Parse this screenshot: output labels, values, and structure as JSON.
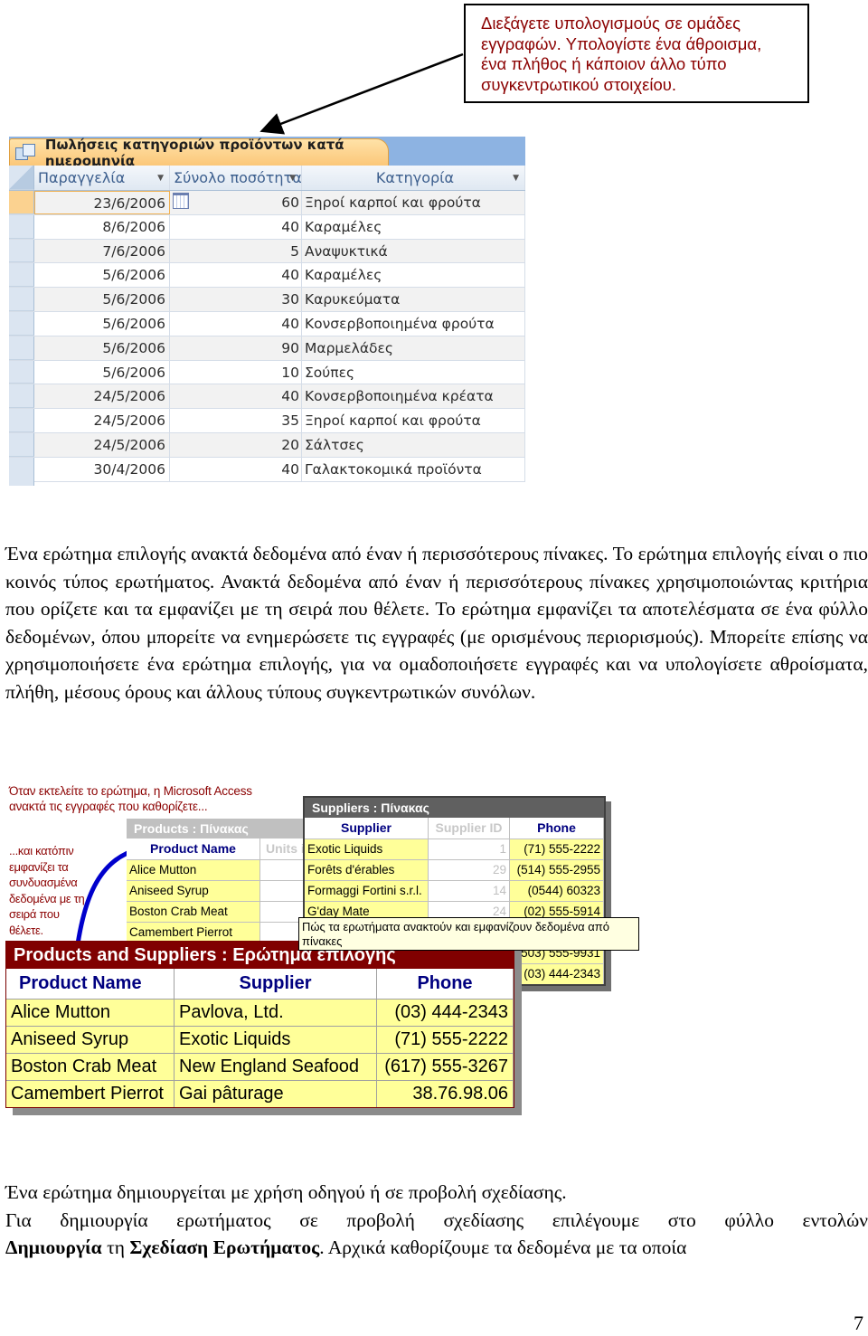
{
  "callout": {
    "lines": [
      "Διεξάγετε υπολογισμούς σε ομάδες",
      "εγγραφών. Υπολογίστε ένα άθροισμα,",
      "ένα πλήθος ή κάποιον άλλο τύπο",
      "συγκεντρωτικού στοιχείου."
    ]
  },
  "datasheet": {
    "tab_title": "Πωλήσεις κατηγοριών προϊόντων κατά ημερομηνία",
    "tab_icon": "query-datasheet-icon",
    "columns": [
      "Παραγγελία",
      "Σύνολο ποσότητα",
      "Κατηγορία"
    ],
    "rows": [
      {
        "date": "23/6/2006",
        "qty": "60",
        "category": "Ξηροί καρποί και φρούτα"
      },
      {
        "date": "8/6/2006",
        "qty": "40",
        "category": "Καραμέλες"
      },
      {
        "date": "7/6/2006",
        "qty": "5",
        "category": "Αναψυκτικά"
      },
      {
        "date": "5/6/2006",
        "qty": "40",
        "category": "Καραμέλες"
      },
      {
        "date": "5/6/2006",
        "qty": "30",
        "category": "Καρυκεύματα"
      },
      {
        "date": "5/6/2006",
        "qty": "40",
        "category": "Κονσερβοποιημένα φρούτα"
      },
      {
        "date": "5/6/2006",
        "qty": "90",
        "category": "Μαρμελάδες"
      },
      {
        "date": "5/6/2006",
        "qty": "10",
        "category": "Σούπες"
      },
      {
        "date": "24/5/2006",
        "qty": "40",
        "category": "Κονσερβοποιημένα κρέατα"
      },
      {
        "date": "24/5/2006",
        "qty": "35",
        "category": "Ξηροί καρποί και φρούτα"
      },
      {
        "date": "24/5/2006",
        "qty": "20",
        "category": "Σάλτσες"
      },
      {
        "date": "30/4/2006",
        "qty": "40",
        "category": "Γαλακτοκομικά προϊόντα"
      }
    ]
  },
  "paragraph1": "Ένα ερώτημα επιλογής ανακτά δεδομένα από έναν ή περισσότερους πίνακες. Το ερώτημα επιλογής είναι ο πιο κοινός τύπος ερωτήματος. Ανακτά δεδομένα από έναν ή περισσότερους πίνακες χρησιμοποιώντας κριτήρια που ορίζετε και τα εμφανίζει με τη σειρά που θέλετε. Το ερώτημα εμφανίζει τα αποτελέσματα σε ένα φύλλο δεδομένων, όπου μπορείτε να ενημερώσετε τις εγγραφές (με ορισμένους περιορισμούς). Μπορείτε επίσης να χρησιμοποιήσετε ένα ερώτημα επιλογής, για να ομαδοποιήσετε εγγραφές και να υπολογίσετε αθροίσματα, πλήθη, μέσους όρους και άλλους τύπους συγκεντρωτικών συνόλων.",
  "figure": {
    "intro_line1": "Όταν εκτελείτε το ερώτημα, η Microsoft Access",
    "intro_line2": "ανακτά τις εγγραφές που καθορίζετε...",
    "side_text": "...και κατόπιν εμφανίζει τα συνδυασμένα δεδομένα με τη σειρά που θέλετε.",
    "products_table": {
      "title": "Products : Πίνακας",
      "columns": [
        "Product Name",
        "Units i"
      ],
      "rows": [
        "Alice Mutton",
        "Aniseed Syrup",
        "Boston Crab Meat",
        "Camembert Pierrot"
      ]
    },
    "suppliers_table": {
      "title": "Suppliers : Πίνακας",
      "columns": [
        "Supplier",
        "Supplier ID",
        "Phone"
      ],
      "rows": [
        {
          "supplier": "Exotic Liquids",
          "id": "1",
          "phone": "(71) 555-2222"
        },
        {
          "supplier": "Forêts d'érables",
          "id": "29",
          "phone": "(514) 555-2955"
        },
        {
          "supplier": "Formaggi Fortini s.r.l.",
          "id": "14",
          "phone": "(0544) 60323"
        },
        {
          "supplier": "G'day Mate",
          "id": "24",
          "phone": "(02) 555-5914"
        },
        {
          "supplier": "",
          "id": "",
          "phone": ""
        },
        {
          "supplier": "",
          "id": "",
          "phone": "(503) 555-9931"
        },
        {
          "supplier": "",
          "id": "",
          "phone": "(03) 444-2343"
        }
      ]
    },
    "tooltip": "Πώς τα ερωτήματα ανακτούν και εμφανίζουν δεδομένα από πίνακες",
    "query_table": {
      "title": "Products and Suppliers : Ερώτημα επιλογής",
      "columns": [
        "Product Name",
        "Supplier",
        "Phone"
      ],
      "rows": [
        {
          "product": "Alice Mutton",
          "supplier": "Pavlova, Ltd.",
          "phone": "(03) 444-2343"
        },
        {
          "product": "Aniseed Syrup",
          "supplier": "Exotic Liquids",
          "phone": "(71) 555-2222"
        },
        {
          "product": "Boston Crab Meat",
          "supplier": "New England Seafood",
          "phone": "(617) 555-3267"
        },
        {
          "product": "Camembert Pierrot",
          "supplier": "Gai pâturage",
          "phone": "38.76.98.06"
        }
      ]
    }
  },
  "paragraph2": {
    "line1": "Ένα ερώτημα δημιουργείται με χρήση οδηγού ή σε προβολή σχεδίασης.",
    "line2": "Για δημιουργία ερωτήματος σε προβολή σχεδίασης επιλέγουμε στο φύλλο εντολών",
    "bold1": "Δημιουργία",
    "mid1": " τη ",
    "bold2": "Σχεδίαση Ερωτήματος",
    "tail": ". Αρχικά καθορίζουμε τα δεδομένα με τα οποία"
  },
  "page_number": "7",
  "colors": {
    "callout_text": "#8b0000",
    "tab_orange": "#fbc779",
    "tab_bar_blue": "#8db3e2",
    "header_blue": "#3d5f8e",
    "arrow_blue": "#0000cc",
    "query_title_bg": "#800000",
    "cell_yellow": "#ffff99"
  }
}
